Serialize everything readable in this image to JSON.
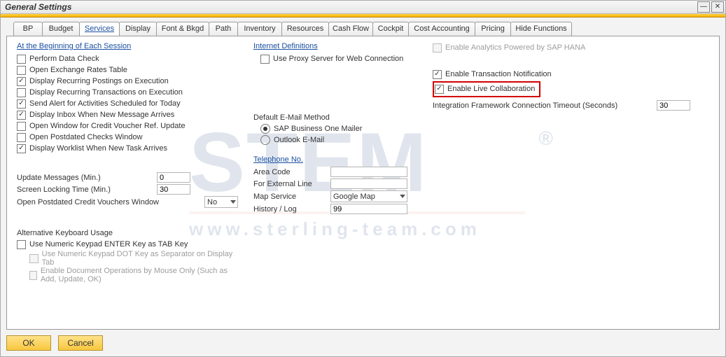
{
  "window": {
    "title": "General Settings",
    "minimize": "—",
    "close": "✕"
  },
  "tabs": [
    "BP",
    "Budget",
    "Services",
    "Display",
    "Font & Bkgd",
    "Path",
    "Inventory",
    "Resources",
    "Cash Flow",
    "Cockpit",
    "Cost Accounting",
    "Pricing",
    "Hide Functions"
  ],
  "active_tab_index": 2,
  "col1": {
    "header": "At the Beginning of Each Session",
    "checks": [
      {
        "label": "Perform Data Check",
        "checked": false
      },
      {
        "label": "Open Exchange Rates Table",
        "checked": false
      },
      {
        "label": "Display Recurring Postings on Execution",
        "checked": true
      },
      {
        "label": "Display Recurring Transactions on Execution",
        "checked": false
      },
      {
        "label": "Send Alert for Activities Scheduled for Today",
        "checked": true
      },
      {
        "label": "Display Inbox When New Message Arrives",
        "checked": true
      },
      {
        "label": "Open Window for Credit Voucher Ref. Update",
        "checked": false
      },
      {
        "label": "Open Postdated Checks Window",
        "checked": false
      },
      {
        "label": "Display Worklist When New Task Arrives",
        "checked": true
      }
    ],
    "fields": {
      "update_messages": {
        "label": "Update Messages (Min.)",
        "value": "0"
      },
      "screen_lock": {
        "label": "Screen Locking Time (Min.)",
        "value": "30"
      },
      "postdated": {
        "label": "Open Postdated Credit Vouchers Window",
        "value": "No"
      }
    },
    "alt_header": "Alternative Keyboard Usage",
    "alt_checks": [
      {
        "label": "Use Numeric Keypad ENTER Key as TAB Key",
        "checked": false,
        "disabled": false
      },
      {
        "label": "Use Numeric Keypad DOT Key as Separator on Display Tab",
        "checked": false,
        "disabled": true
      },
      {
        "label": "Enable Document Operations by Mouse Only (Such as Add, Update, OK)",
        "checked": false,
        "disabled": true
      }
    ]
  },
  "col2": {
    "internet_header": "Internet Definitions",
    "proxy": {
      "label": "Use Proxy Server for Web Connection",
      "checked": false
    },
    "email_header": "Default E-Mail Method",
    "radios": [
      {
        "label": "SAP Business One Mailer",
        "checked": true
      },
      {
        "label": "Outlook E-Mail",
        "checked": false
      }
    ],
    "tel_header": "Telephone No.",
    "tel_fields": {
      "area": {
        "label": "Area Code",
        "value": ""
      },
      "ext": {
        "label": "For External Line",
        "value": ""
      },
      "map": {
        "label": "Map Service",
        "value": "Google Map"
      },
      "hist": {
        "label": "History / Log",
        "value": "99"
      }
    }
  },
  "col3": {
    "hana": {
      "label": "Enable Analytics Powered by SAP HANA",
      "checked": false,
      "disabled": true
    },
    "trans": {
      "label": "Enable Transaction Notification",
      "checked": true
    },
    "live": {
      "label": "Enable Live Collaboration",
      "checked": true
    },
    "timeout": {
      "label": "Integration Framework Connection Timeout (Seconds)",
      "value": "30"
    }
  },
  "buttons": {
    "ok": "OK",
    "cancel": "Cancel"
  },
  "watermark": {
    "big": "STEM",
    "url": "www.sterling-team.com",
    "reg": "®"
  }
}
